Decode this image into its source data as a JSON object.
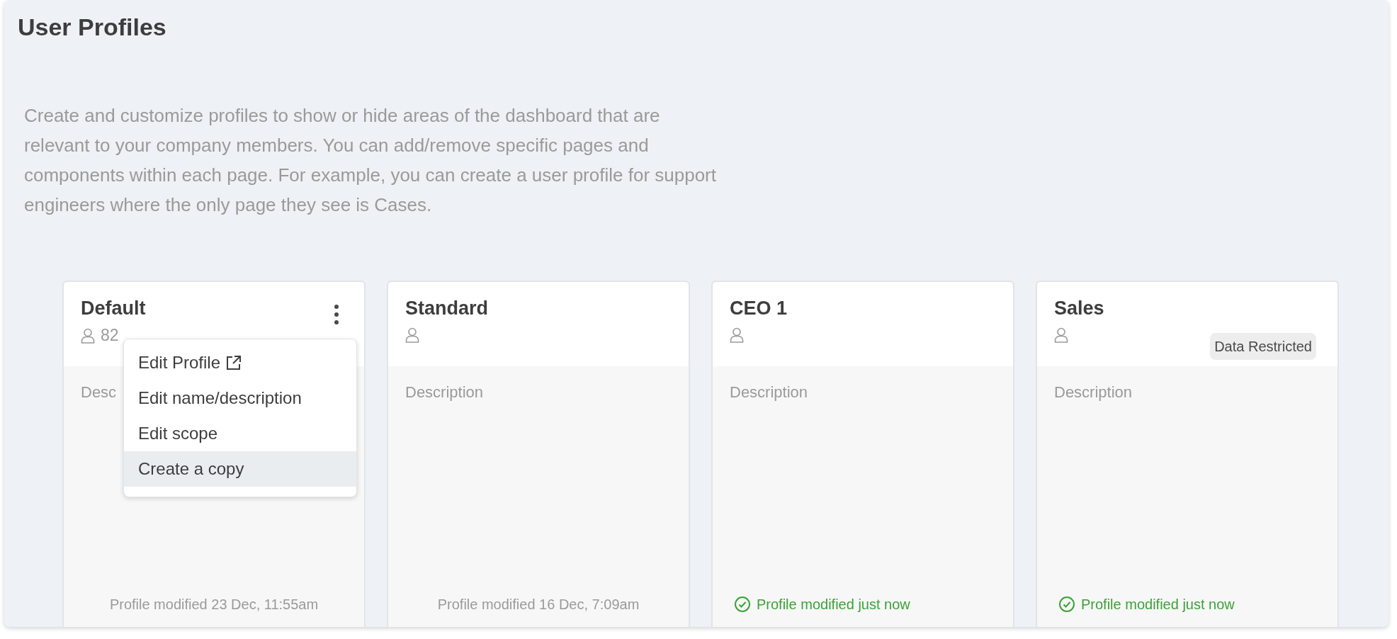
{
  "page": {
    "title": "User Profiles",
    "intro": "Create and customize profiles to show or hide areas of the dashboard that are relevant to your company members. You can add/remove specific pages and components within each page. For example, you can create a user profile for support engineers where the only page they see is Cases."
  },
  "cards": [
    {
      "name": "Default",
      "users": "82",
      "description": "Desc",
      "modified": "Profile modified 23 Dec, 11:55am",
      "kind": "plain",
      "menu_button": true,
      "menu": [
        {
          "label": "Edit Profile",
          "external": true,
          "highlighted": false
        },
        {
          "label": "Edit name/description",
          "external": false,
          "highlighted": false
        },
        {
          "label": "Edit scope",
          "external": false,
          "highlighted": false
        },
        {
          "label": "Create a copy",
          "external": false,
          "highlighted": true
        }
      ]
    },
    {
      "name": "Standard",
      "description": "Description",
      "modified": "Profile modified 16 Dec, 7:09am",
      "kind": "plain",
      "menu_button": false
    },
    {
      "name": "CEO 1",
      "description": "Description",
      "modified": "Profile modified just now",
      "kind": "saved",
      "menu_button": false
    },
    {
      "name": "Sales",
      "description": "Description",
      "modified": "Profile modified just now",
      "kind": "saved",
      "menu_button": false,
      "badge": "Data Restricted"
    }
  ]
}
